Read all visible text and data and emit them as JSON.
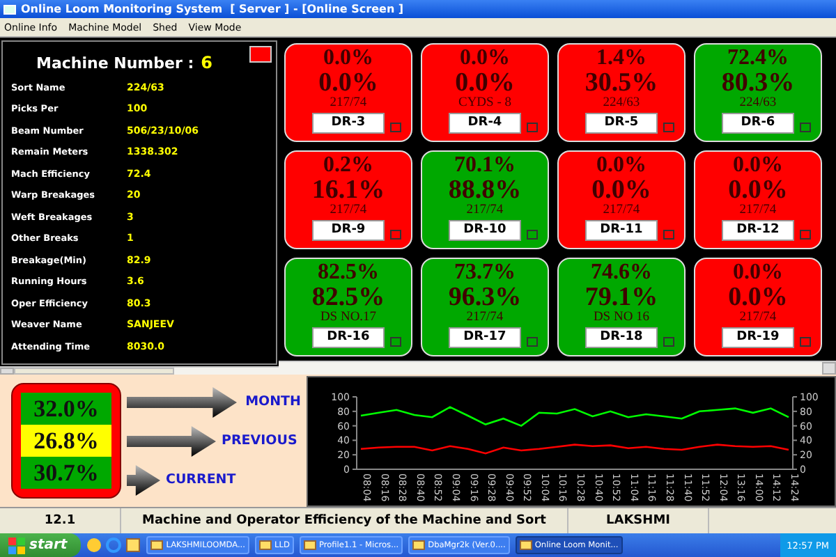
{
  "window": {
    "title": "Online Loom Monitoring System  [ Server ] - [Online Screen ]"
  },
  "menu": [
    "Online Info",
    "Machine Model",
    "Shed",
    "View Mode"
  ],
  "machine_panel": {
    "heading": "Machine Number :",
    "number": "6",
    "alarm": true,
    "fields": [
      {
        "label": "Sort Name",
        "value": "224/63"
      },
      {
        "label": "Picks Per",
        "value": "100"
      },
      {
        "label": "Beam Number",
        "value": "506/23/10/06"
      },
      {
        "label": "Remain Meters",
        "value": "1338.302"
      },
      {
        "label": "Mach Efficiency",
        "value": "72.4"
      },
      {
        "label": "Warp Breakages",
        "value": "20"
      },
      {
        "label": "Weft Breakages",
        "value": "3"
      },
      {
        "label": "Other Breaks",
        "value": "1"
      },
      {
        "label": "Breakage(Min)",
        "value": "82.9"
      },
      {
        "label": "Running Hours",
        "value": "3.6"
      },
      {
        "label": "Oper Efficiency",
        "value": "80.3"
      },
      {
        "label": "Weaver Name",
        "value": "SANJEEV"
      },
      {
        "label": "Attending Time",
        "value": "8030.0"
      }
    ]
  },
  "machines": [
    {
      "mach_eff": "0.0%",
      "oper_eff": "0.0%",
      "sort": "217/74",
      "name": "DR-3",
      "color": "#ff0000"
    },
    {
      "mach_eff": "0.0%",
      "oper_eff": "0.0%",
      "sort": "CYDS - 8",
      "name": "DR-4",
      "color": "#ff0000"
    },
    {
      "mach_eff": "1.4%",
      "oper_eff": "30.5%",
      "sort": "224/63",
      "name": "DR-5",
      "color": "#ff0000"
    },
    {
      "mach_eff": "72.4%",
      "oper_eff": "80.3%",
      "sort": "224/63",
      "name": "DR-6",
      "color": "#00a800"
    },
    {
      "mach_eff": "0.2%",
      "oper_eff": "16.1%",
      "sort": "217/74",
      "name": "DR-9",
      "color": "#ff0000"
    },
    {
      "mach_eff": "70.1%",
      "oper_eff": "88.8%",
      "sort": "217/74",
      "name": "DR-10",
      "color": "#00a800"
    },
    {
      "mach_eff": "0.0%",
      "oper_eff": "0.0%",
      "sort": "217/74",
      "name": "DR-11",
      "color": "#ff0000"
    },
    {
      "mach_eff": "0.0%",
      "oper_eff": "0.0%",
      "sort": "217/74",
      "name": "DR-12",
      "color": "#ff0000"
    },
    {
      "mach_eff": "82.5%",
      "oper_eff": "82.5%",
      "sort": "DS NO.17",
      "name": "DR-16",
      "color": "#00a800"
    },
    {
      "mach_eff": "73.7%",
      "oper_eff": "96.3%",
      "sort": "217/74",
      "name": "DR-17",
      "color": "#00a800"
    },
    {
      "mach_eff": "74.6%",
      "oper_eff": "79.1%",
      "sort": "DS NO 16",
      "name": "DR-18",
      "color": "#00a800"
    },
    {
      "mach_eff": "0.0%",
      "oper_eff": "0.0%",
      "sort": "217/74",
      "name": "DR-19",
      "color": "#ff0000"
    }
  ],
  "summary": [
    {
      "value": "32.0%",
      "label": "MONTH",
      "color": "#00a800"
    },
    {
      "value": "26.8%",
      "label": "PREVIOUS",
      "color": "#ffff00"
    },
    {
      "value": "30.7%",
      "label": "CURRENT",
      "color": "#00a800"
    }
  ],
  "trend": {
    "chart_data": {
      "type": "line",
      "categories": [
        "08:04",
        "08:16",
        "08:28",
        "08:40",
        "08:52",
        "09:04",
        "09:16",
        "09:28",
        "09:40",
        "09:52",
        "10:04",
        "10:16",
        "10:28",
        "10:40",
        "10:52",
        "11:04",
        "11:16",
        "11:28",
        "11:40",
        "11:52",
        "12:04",
        "13:16",
        "14:00",
        "14:12",
        "14:24"
      ],
      "ylim": [
        0,
        100
      ],
      "yticks": [
        0,
        20,
        40,
        60,
        80,
        100
      ],
      "y2ticks": [
        0,
        20,
        40,
        60,
        80,
        100
      ],
      "y2lim": [
        0,
        100
      ],
      "series": [
        {
          "color": "#00ff00",
          "values": [
            74,
            78,
            82,
            75,
            72,
            86,
            74,
            62,
            70,
            60,
            78,
            77,
            83,
            73,
            80,
            72,
            76,
            73,
            70,
            80,
            82,
            84,
            78,
            84,
            72
          ]
        },
        {
          "color": "#ff0000",
          "values": [
            28,
            30,
            31,
            31,
            26,
            32,
            28,
            22,
            30,
            26,
            28,
            31,
            34,
            32,
            33,
            29,
            31,
            28,
            27,
            31,
            34,
            32,
            31,
            32,
            27
          ]
        }
      ]
    }
  },
  "status_bar": [
    "12.1",
    "Machine and Operator Efficiency of the Machine and Sort",
    "LAKSHMI"
  ],
  "taskbar": {
    "start": "start",
    "tasks": [
      {
        "label": "LAKSHMILOOMDA...",
        "selected": false
      },
      {
        "label": "LLD",
        "selected": false
      },
      {
        "label": "Profile1.1 - Micros...",
        "selected": false
      },
      {
        "label": "DbaMgr2k (Ver.0....",
        "selected": false
      },
      {
        "label": "Online Loom Monit...",
        "selected": true
      }
    ],
    "clock": "12:57 PM"
  }
}
